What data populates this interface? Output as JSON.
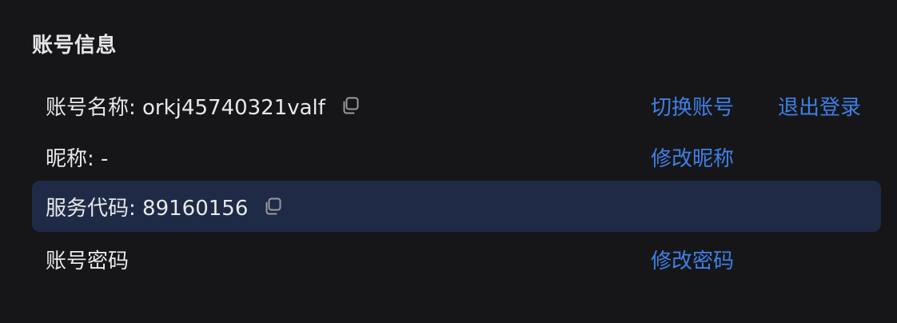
{
  "section": {
    "title": "账号信息"
  },
  "account_name": {
    "label": "账号名称: orkj45740321valf",
    "copy_icon": "copy-icon",
    "switch_action": "切换账号",
    "logout_action": "退出登录"
  },
  "nickname": {
    "label": "昵称: -",
    "edit_action": "修改昵称"
  },
  "service_code": {
    "label": "服务代码: 89160156",
    "copy_icon": "copy-icon"
  },
  "password": {
    "label": "账号密码",
    "edit_action": "修改密码"
  },
  "colors": {
    "background": "#161618",
    "text": "#e8e8ea",
    "link": "#3f7fe6",
    "highlight_row": "#1f2a47"
  }
}
